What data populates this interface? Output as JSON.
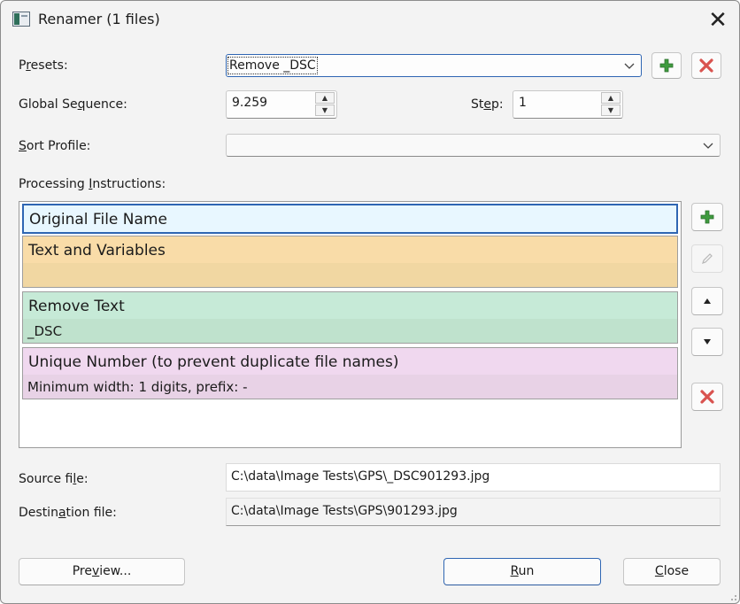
{
  "window": {
    "title": "Renamer (1 files)",
    "close_glyph": "✕"
  },
  "presets": {
    "label_prefix": "P",
    "label_underlined": "r",
    "label_rest": "esets:",
    "value": "Remove _DSC",
    "add_icon": "plus-icon",
    "delete_icon": "delete-icon"
  },
  "global_sequence": {
    "label_prefix": "Global Se",
    "label_underlined": "q",
    "label_rest": "uence:",
    "value": "9.259"
  },
  "step": {
    "label_prefix": "St",
    "label_underlined": "e",
    "label_rest": "p:",
    "value": "1"
  },
  "sort_profile": {
    "label_prefix": "",
    "label_underlined": "S",
    "label_rest": "ort Profile:",
    "value": ""
  },
  "processing": {
    "label_prefix": "Processing ",
    "label_underlined": "I",
    "label_rest": "nstructions:",
    "items": [
      {
        "title": "Original File Name",
        "detail": "",
        "color": "#e8f7ff"
      },
      {
        "title": "Text and Variables",
        "detail": "",
        "color": "#f9dca8"
      },
      {
        "title": "Remove Text",
        "detail": "_DSC",
        "color": "#c6ead7"
      },
      {
        "title": "Unique Number (to prevent duplicate file names)",
        "detail": "Minimum width: 1 digits, prefix: -",
        "color": "#f0d8ef"
      }
    ],
    "side_buttons": [
      "plus-icon",
      "pencil-icon",
      "arrow-up-icon",
      "arrow-down-icon",
      "delete-icon"
    ]
  },
  "source_file": {
    "label_prefix": "Source fi",
    "label_underlined": "l",
    "label_rest": "e:",
    "value": "C:\\data\\Image Tests\\GPS\\_DSC901293.jpg"
  },
  "destination_file": {
    "label_prefix": "Destin",
    "label_underlined": "a",
    "label_rest": "tion file:",
    "value": "C:\\data\\Image Tests\\GPS\\901293.jpg"
  },
  "buttons": {
    "preview": {
      "prefix": "Pre",
      "underlined": "v",
      "rest": "iew..."
    },
    "run": {
      "prefix": "",
      "underlined": "R",
      "rest": "un"
    },
    "close": {
      "prefix": "",
      "underlined": "C",
      "rest": "lose"
    }
  },
  "colors": {
    "plus": "#3f9b3f",
    "delete": "#d9534f",
    "focus": "#2f66b3"
  }
}
